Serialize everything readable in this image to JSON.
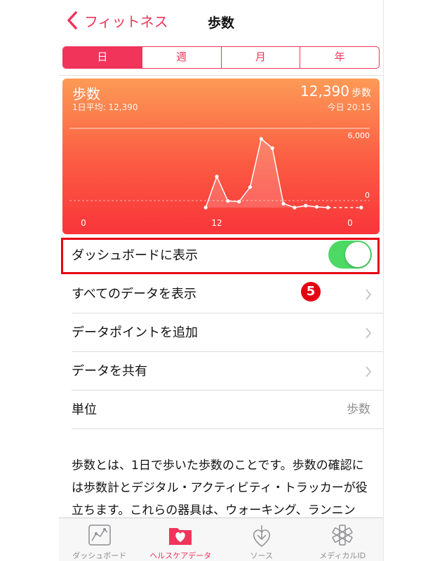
{
  "nav": {
    "back_label": "フィットネス",
    "title": "歩数"
  },
  "segments": [
    {
      "label": "日",
      "active": true
    },
    {
      "label": "週",
      "active": false
    },
    {
      "label": "月",
      "active": false
    },
    {
      "label": "年",
      "active": false
    }
  ],
  "chart_card": {
    "title": "歩数",
    "average": "1日平均: 12,390",
    "value": "12,390",
    "unit": "歩数",
    "timestamp": "今日 20:15",
    "max_label": "6,000",
    "min_label": "0"
  },
  "chart_data": {
    "type": "line",
    "x": [
      11,
      12,
      13,
      14,
      15,
      16,
      17,
      18,
      19,
      20,
      21,
      22,
      23,
      24,
      25,
      26
    ],
    "values": [
      0,
      2350,
      500,
      450,
      1550,
      5200,
      4500,
      300,
      0,
      150,
      50,
      0,
      null,
      null,
      0
    ],
    "x_tick_labels": [
      "0",
      "12",
      "0"
    ],
    "ylim": [
      0,
      6000
    ],
    "y_gridlines": [
      "6,000",
      "0"
    ],
    "grid": true
  },
  "rows": {
    "dashboard": "ダッシュボードに表示",
    "all_data": "すべてのデータを表示",
    "add_point": "データポイントを追加",
    "share": "データを共有",
    "unit_label": "単位",
    "unit_value": "歩数"
  },
  "toggle_on": true,
  "badge": "5",
  "description": "歩数とは、1日で歩いた歩数のことです。歩数の確認には歩数計とデジタル・アクティビティ・トラッカーが役立ちます。これらの器具は、ウォーキング、ランニング、階段上り、クロスカ",
  "tabs": [
    {
      "label": "ダッシュボード",
      "icon": "dashboard-icon"
    },
    {
      "label": "ヘルスケアデータ",
      "icon": "health-data-icon"
    },
    {
      "label": "ソース",
      "icon": "sources-icon"
    },
    {
      "label": "メディカルID",
      "icon": "medical-id-icon"
    }
  ],
  "colors": {
    "accent": "#f0345a",
    "toggle": "#4cd964",
    "highlight": "#e60012"
  }
}
